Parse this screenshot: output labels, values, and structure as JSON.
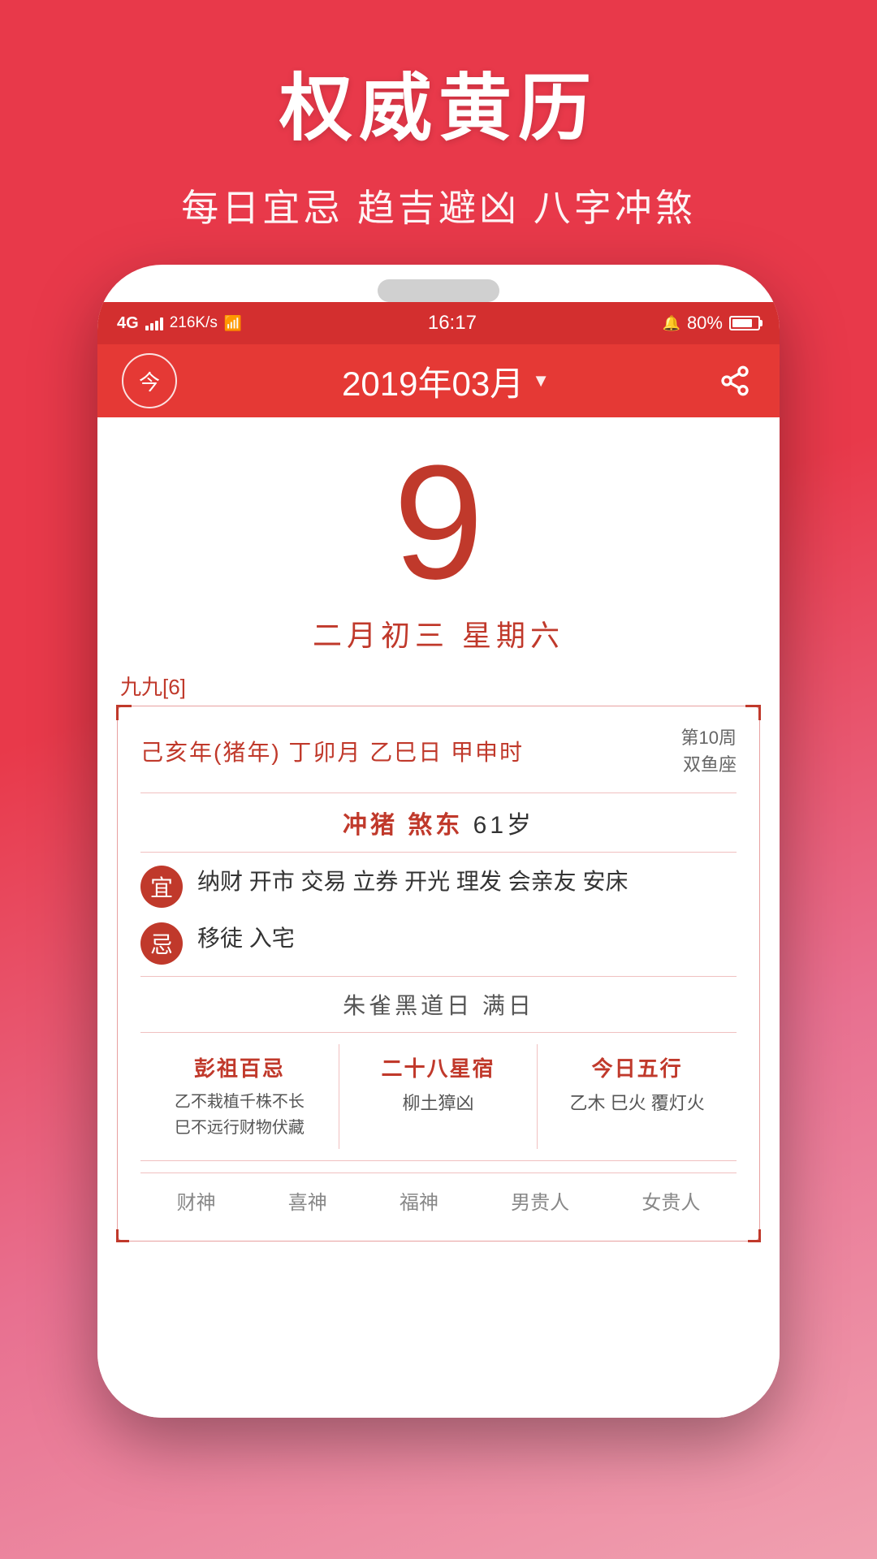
{
  "app": {
    "title": "权威黄历",
    "subtitle": "每日宜忌 趋吉避凶 八字冲煞"
  },
  "statusBar": {
    "network": "4G",
    "speed": "216K/s",
    "wifi": "WiFi",
    "time": "16:17",
    "alarm": "🔔",
    "battery": "80%"
  },
  "navBar": {
    "todayLabel": "今",
    "dateLabel": "2019年03月",
    "shareLabel": "分享"
  },
  "daySection": {
    "dayNumber": "9",
    "lunarDay": "二月初三  星期六"
  },
  "infoCard": {
    "jiuLabel": "九九[6]",
    "ganzhi": "己亥年(猪年) 丁卯月  乙巳日  甲申时",
    "weekZodiac": "第10周\n双鱼座",
    "chong": "冲猪  煞东",
    "age": "61岁",
    "yi": "纳财 开市 交易 立券 开光 理发 会亲友 安床",
    "ji": "移徒 入宅",
    "specialDay": "朱雀黑道日  满日",
    "pengZuLabel": "彭祖百忌",
    "pengZuContent": "乙不栽植千株不长\n巳不远行财物伏藏",
    "starLabel": "二十八星宿",
    "starContent": "柳土獐凶",
    "wuxingLabel": "今日五行",
    "wuxingContent": "乙木 巳火 覆灯火",
    "bottomLabels": [
      "财神",
      "喜神",
      "福神",
      "男贵人",
      "女贵人"
    ]
  }
}
